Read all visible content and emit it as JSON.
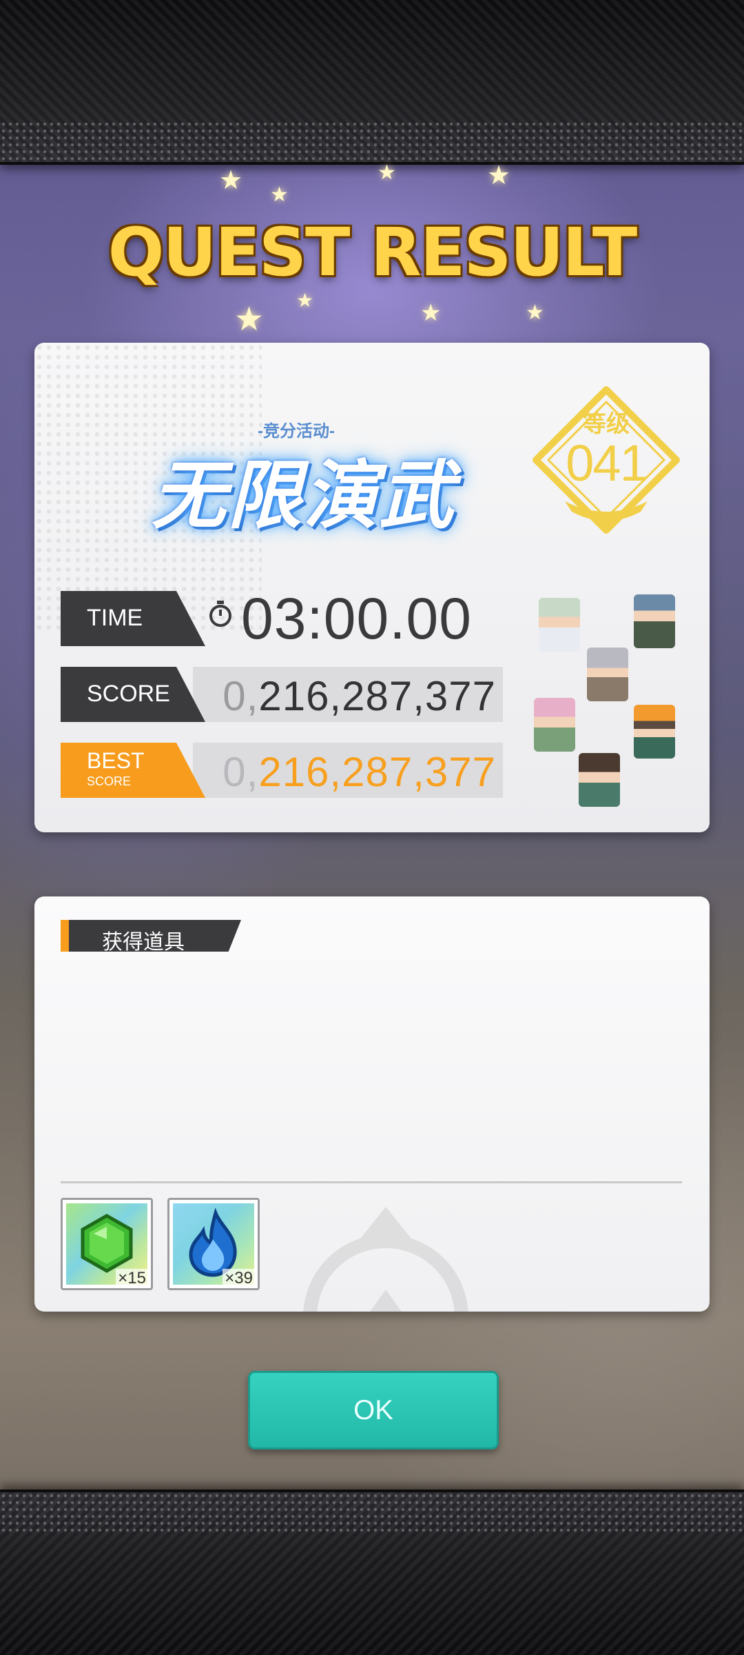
{
  "title": "QUEST RESULT",
  "event": {
    "subtitle": "-竞分活动-",
    "name": "无限演武"
  },
  "rank": {
    "label": "等级",
    "value": "041"
  },
  "stats": {
    "time_label": "TIME",
    "time_value": "03:00.00",
    "score_label": "SCORE",
    "score_pad": "0,",
    "score_value": "216,287,377",
    "best_label": "BEST",
    "best_sub": "SCORE",
    "best_pad": "0,",
    "best_value": "216,287,377"
  },
  "items_section": {
    "header": "获得道具",
    "items": [
      {
        "icon": "green-gem-icon",
        "count": "×15"
      },
      {
        "icon": "blue-flame-icon",
        "count": "×39"
      }
    ]
  },
  "ok_button": "OK",
  "colors": {
    "accent_orange": "#f79c1d",
    "button_teal": "#2cc7b5",
    "title_gold": "#ffd44a",
    "rank_gold": "#f2cf48",
    "event_blue": "#4aa3ff"
  }
}
